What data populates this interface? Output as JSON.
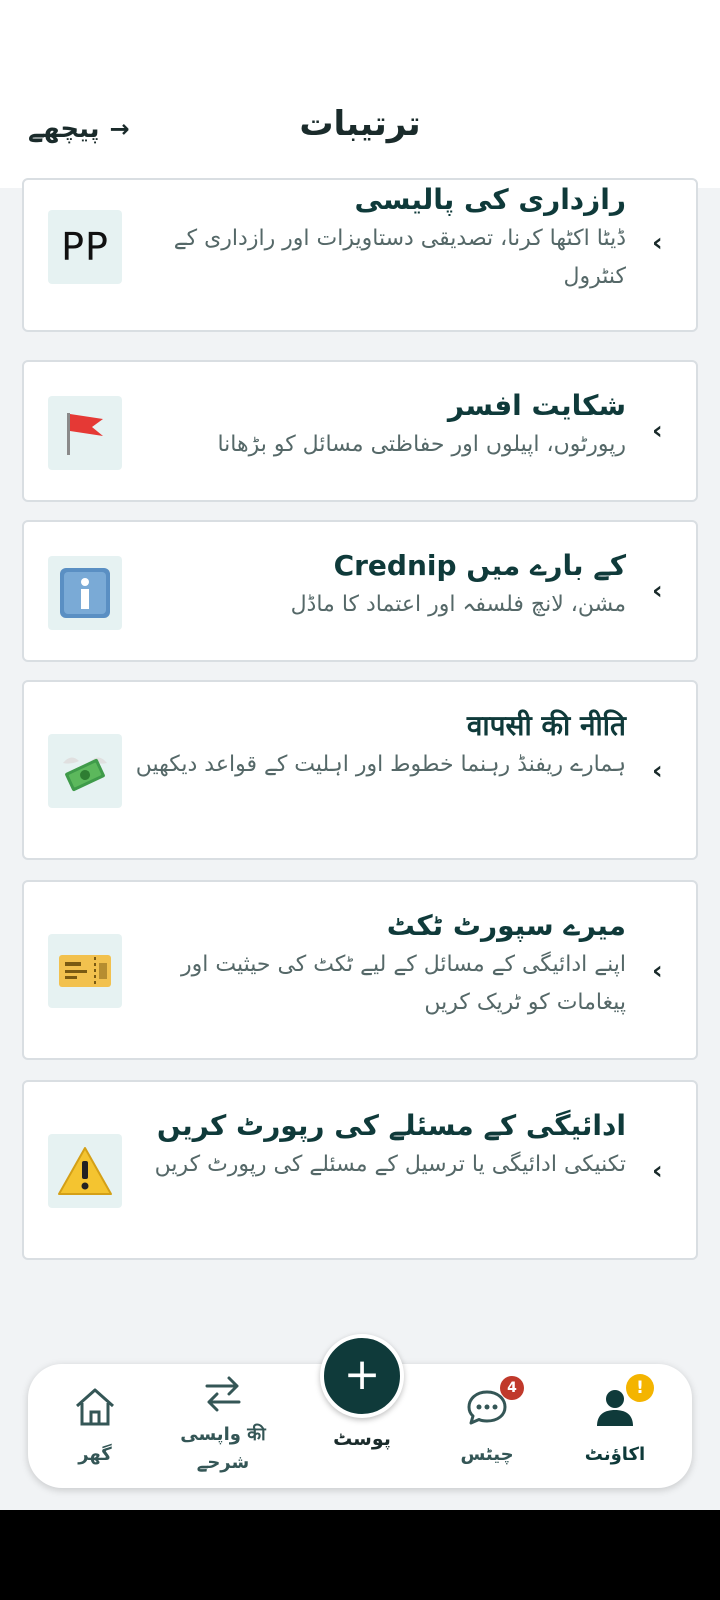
{
  "header": {
    "title": "ترتیبات",
    "back_label": "پیچھے",
    "back_arrow": "→"
  },
  "cards": [
    {
      "title": "رازداری کی پالیسی",
      "desc": "ڈیٹا اکٹھا کرنا، تصدیقی دستاویزات اور رازداری کے کنٹرول",
      "icon_name": "pp-text-icon",
      "icon_text": "PP"
    },
    {
      "title": "شکایت افسر",
      "desc": "رپورٹوں، اپیلوں اور حفاظتی مسائل کو بڑھانا",
      "icon_name": "red-flag-icon"
    },
    {
      "title": "کے بارے میں Crednip",
      "desc": "مشن، لانچ فلسفہ اور اعتماد کا ماڈل",
      "icon_name": "info-icon"
    },
    {
      "title": "वापसी की नीति",
      "desc": "ہمارے ریفنڈ رہنما خطوط اور اہلیت کے قواعد دیکھیں",
      "icon_name": "money-wings-icon"
    },
    {
      "title": "میرے سپورٹ ٹکٹ",
      "desc": "اپنے ادائیگی کے مسائل کے لیے ٹکٹ کی حیثیت اور پیغامات کو ٹریک کریں",
      "icon_name": "ticket-icon"
    },
    {
      "title": "ادائیگی کے مسئلے کی رپورٹ کریں",
      "desc": "تکنیکی ادائیگی یا ترسیل کے مسئلے کی رپورٹ کریں",
      "icon_name": "warning-icon"
    }
  ],
  "chevron": "‹",
  "nav": {
    "home": "گھر",
    "returns_line1": "واپسی की",
    "returns_line2": "شرحے",
    "post": "پوسٹ",
    "chats": "چیٹس",
    "chats_badge": "4",
    "account": "اکاؤنٹ",
    "account_badge": "!"
  },
  "colors": {
    "primary": "#0f3a3a",
    "badge_red": "#c0392b",
    "badge_yellow": "#f4b400"
  }
}
